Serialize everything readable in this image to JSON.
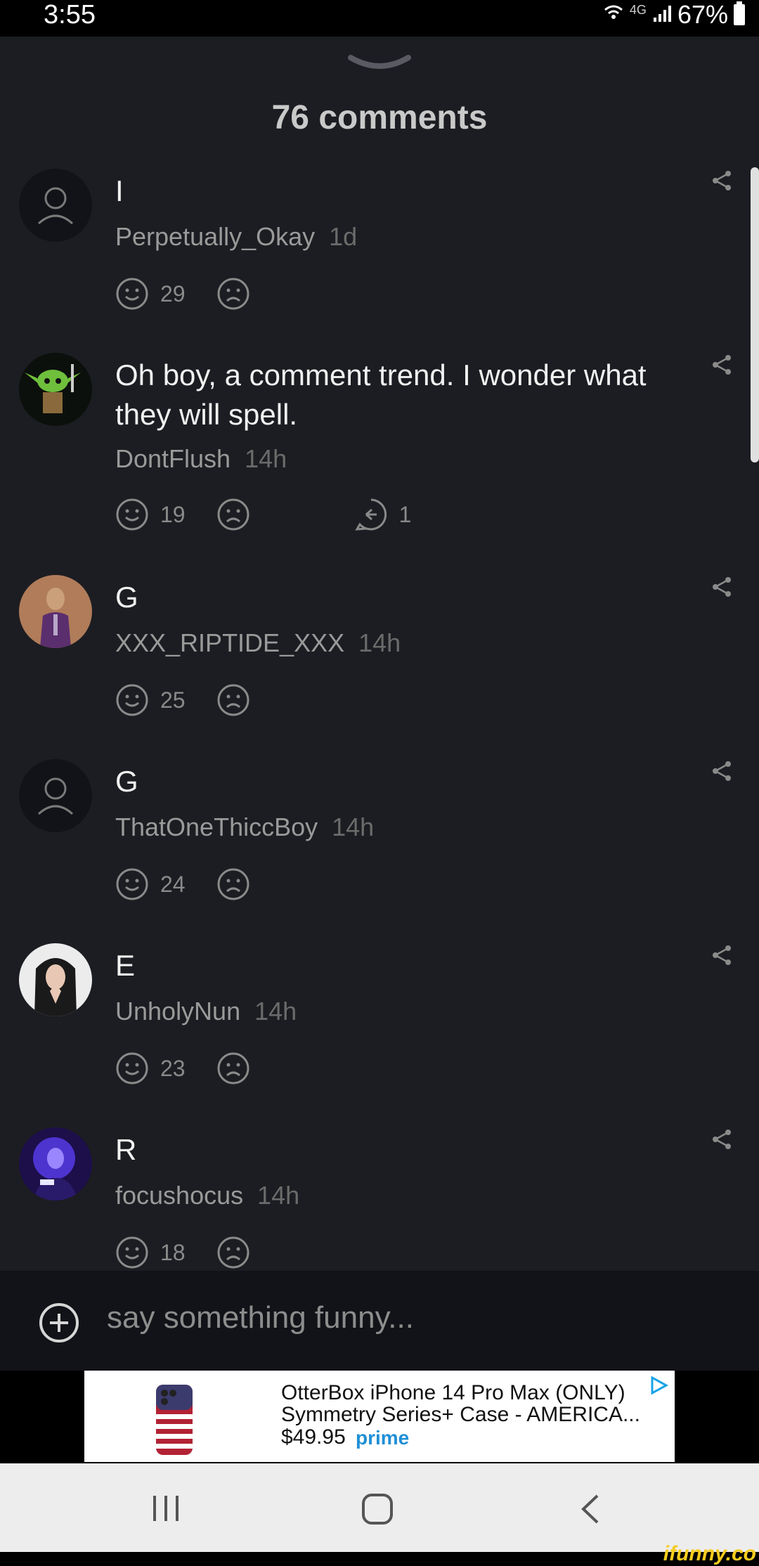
{
  "status": {
    "time": "3:55",
    "network": "4G",
    "battery": "67%"
  },
  "sheet": {
    "title": "76 comments"
  },
  "comments": [
    {
      "text": "I",
      "user": "Perpetually_Okay",
      "time": "1d",
      "likes": "29",
      "replies": ""
    },
    {
      "text": "Oh boy, a comment trend. I wonder what they will spell.",
      "user": "DontFlush",
      "time": "14h",
      "likes": "19",
      "replies": "1"
    },
    {
      "text": "G",
      "user": "XXX_RIPTIDE_XXX",
      "time": "14h",
      "likes": "25",
      "replies": ""
    },
    {
      "text": "G",
      "user": "ThatOneThiccBoy",
      "time": "14h",
      "likes": "24",
      "replies": ""
    },
    {
      "text": "E",
      "user": "UnholyNun",
      "time": "14h",
      "likes": "23",
      "replies": ""
    },
    {
      "text": "R",
      "user": "focushocus",
      "time": "14h",
      "likes": "18",
      "replies": ""
    }
  ],
  "input": {
    "placeholder": "say something funny..."
  },
  "ad": {
    "title": "OtterBox iPhone 14 Pro Max (ONLY) Symmetry Series+ Case - AMERICA...",
    "price": "$49.95",
    "prime": "prime"
  },
  "watermark": "ifunny.co",
  "colors": {
    "sheet_bg": "#1c1d22",
    "input_bg": "#121318",
    "muted_text": "#9a9a9a",
    "accent_prime": "#1f8fd6",
    "watermark": "#f6cc1d"
  }
}
